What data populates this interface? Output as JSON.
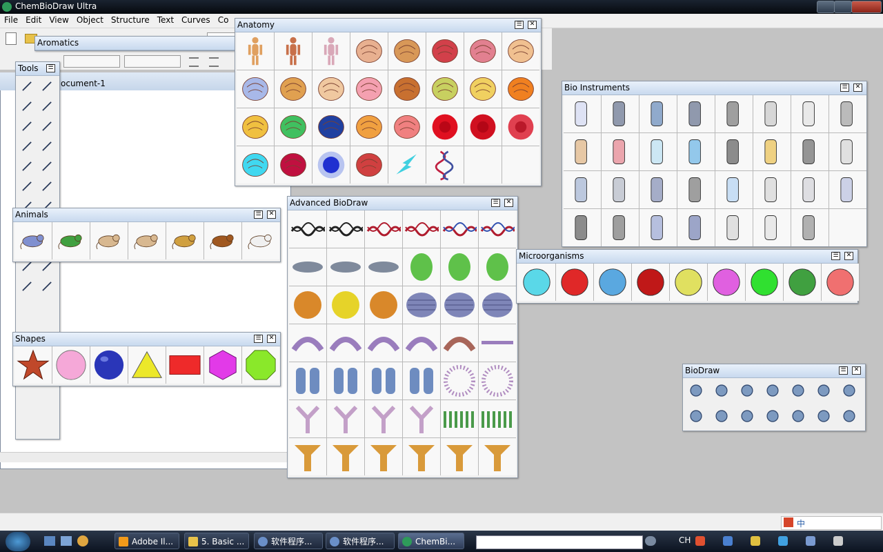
{
  "app": {
    "title": "ChemBioDraw Ultra"
  },
  "menu": [
    "File",
    "Edit",
    "View",
    "Object",
    "Structure",
    "Text",
    "Curves",
    "Co"
  ],
  "document": {
    "tab_label": "ocument-1"
  },
  "palettes": {
    "aromatics": "Aromatics",
    "tools": "Tools",
    "anatomy": "Anatomy",
    "animals": "Animals",
    "shapes": "Shapes",
    "advanced_biodraw": "Advanced BioDraw",
    "bio_instruments": "Bio Instruments",
    "microorganisms": "Microorganisms",
    "biodraw": "BioDraw"
  },
  "icons": {
    "anatomy": [
      "male-figure",
      "male-figure-brown",
      "female-figure",
      "head-brain",
      "brain",
      "heart-red",
      "heart-pink",
      "pancreas",
      "intestines",
      "kidney",
      "lungs",
      "thyroid",
      "liver",
      "stomach",
      "neuron-yellow",
      "neuron-orange",
      "neuron-cell",
      "neuron-green",
      "chromosome-set",
      "chromosome-orange",
      "chromosome-pink",
      "red-blood-cell",
      "red-blood-cell-dark",
      "blood-cells-stack",
      "cyan-cell",
      "tumor-cell",
      "blue-cell",
      "muscle-tissue",
      "lightning-cyan",
      "dna-helix",
      "",
      ""
    ],
    "animals": [
      "fly",
      "mosquito",
      "rat",
      "rabbit",
      "monkey",
      "mouse-brown",
      "mouse-white"
    ],
    "shapes": [
      "star",
      "pink-circle",
      "blue-sphere",
      "yellow-triangle",
      "red-rectangle",
      "magenta-hexagon",
      "green-octagon"
    ],
    "bio_instruments": [
      "beaker",
      "syringe",
      "dropper",
      "scalpel",
      "scissors",
      "mortar",
      "flask",
      "balance",
      "tube-rack",
      "tube-rack-colored",
      "test-tube",
      "blue-tube",
      "microscope",
      "bunsen-burner",
      "burner-lamp",
      "wash-bottle",
      "well-plate",
      "microplate",
      "pipette-tip",
      "goggles",
      "tray",
      "petri-dish",
      "culture-dish",
      "petri-blue",
      "micropipette",
      "dispenser",
      "apparatus",
      "stand-pipette",
      "gloved-hand",
      "glove",
      "graduated-cylinder",
      ""
    ],
    "microorganisms": [
      "virus-cyan",
      "virus-red",
      "blue-probe",
      "bacteria-red",
      "bacterium-yellow",
      "microbe-purple",
      "phage-green",
      "paramecium",
      "amoeba"
    ],
    "biodraw": [
      "membrane-curve",
      "receptor",
      "antibody",
      "cell-network",
      "channel",
      "helix",
      "virus",
      "hexagon-cell",
      "lobes",
      "protein",
      "beads",
      "arch-protein",
      "cloud",
      "cycle-arrow"
    ]
  },
  "advanced_colors": {
    "dna": [
      "#222",
      "#222",
      "#b01c2e",
      "#b01c2e",
      "#b01c2e",
      "#b01c2e"
    ],
    "blobs": [
      "#7f8a9c",
      "#7f8a9c",
      "#7f8a9c",
      "#5fc14a",
      "#5fc14a",
      "#5fc14a"
    ],
    "organelles": [
      "#d9882a",
      "#e6d329",
      "#d9882a",
      "#7f86b8",
      "#7f86b8",
      "#7f86b8"
    ],
    "golgi": [
      "#9a7dbd",
      "#9a7dbd",
      "#9a7dbd",
      "#9a7dbd",
      "#a8665a",
      "#9a7dbd"
    ],
    "channels": [
      "#6e8cc0",
      "#6e8cc0",
      "#6e8cc0",
      "#6e8cc0",
      "#b08cc0",
      "#b08cc0"
    ],
    "antibody": [
      "#c3a0c8",
      "#c3a0c8",
      "#c3a0c8",
      "#c3a0c8",
      "#4a9a4a",
      "#4a9a4a"
    ],
    "receptors": [
      "#d99a3a",
      "#d99a3a",
      "#d99a3a",
      "#d99a3a",
      "#d99a3a",
      "#d99a3a"
    ]
  },
  "taskbar": {
    "items": [
      "Adobe Il...",
      "5. Basic ...",
      "软件程序...",
      "软件程序...",
      "ChemBi..."
    ],
    "lang": "CH",
    "ime": "中"
  }
}
